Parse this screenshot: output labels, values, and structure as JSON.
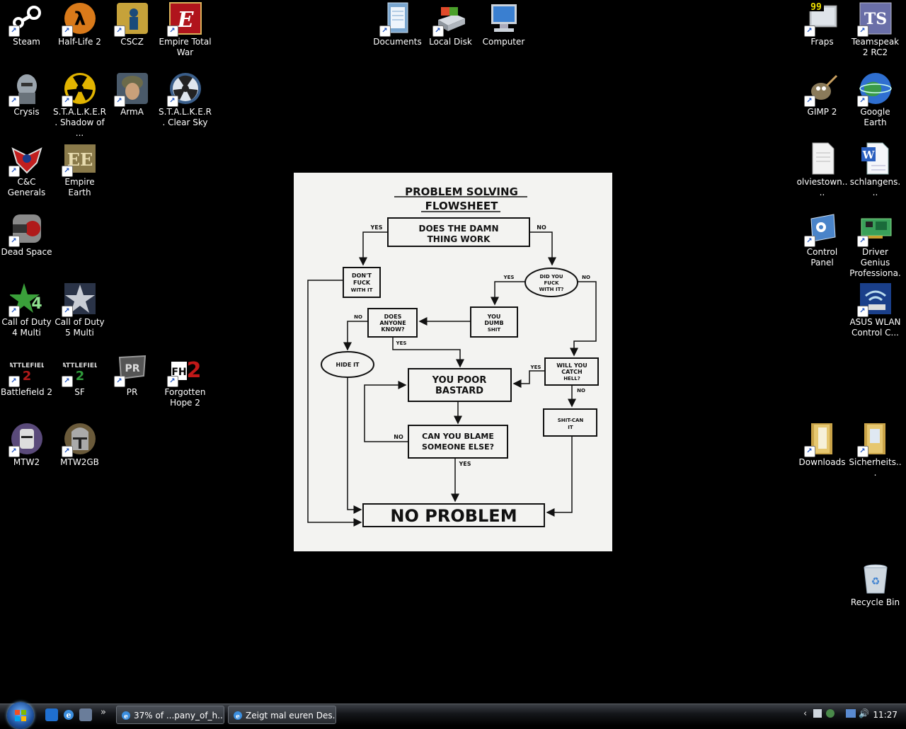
{
  "desktop": {
    "icons": [
      {
        "label": "Steam",
        "icon": "steam-icon",
        "color": "#2a2a2a"
      },
      {
        "label": "Half-Life 2",
        "icon": "half-life-icon",
        "color": "#d97a1a"
      },
      {
        "label": "CSCZ",
        "icon": "counter-strike-icon",
        "color": "#c6a23a"
      },
      {
        "label": "Empire Total War",
        "icon": "empire-total-war-icon",
        "color": "#b0141c"
      },
      {
        "label": "Crysis",
        "icon": "crysis-icon",
        "color": "#9aa4ad"
      },
      {
        "label": "S.T.A.L.K.E.R. Shadow of ...",
        "icon": "radiation-icon",
        "color": "#e2b400"
      },
      {
        "label": "ArmA",
        "icon": "soldier-icon",
        "color": "#6b6a4a"
      },
      {
        "label": "S.T.A.L.K.E.R. Clear Sky",
        "icon": "radiation-icon",
        "color": "#3a5e8a"
      },
      {
        "label": "C&C Generals",
        "icon": "eagle-emblem-icon",
        "color": "#c21f1f"
      },
      {
        "label": "Empire Earth",
        "icon": "empire-earth-icon",
        "color": "#8a7a4a"
      },
      {
        "label": "Dead Space",
        "icon": "dead-space-icon",
        "color": "#8a8a8a"
      },
      {
        "label": "Call of Duty 4 Multi",
        "icon": "cod4-icon",
        "color": "#3aa03a"
      },
      {
        "label": "Call of Duty 5 Multi",
        "icon": "star-icon",
        "color": "#4a5a7a"
      },
      {
        "label": "Battlefield 2",
        "icon": "battlefield-icon",
        "color": "#3a3a3a"
      },
      {
        "label": "SF",
        "icon": "battlefield-icon",
        "color": "#3a3a3a"
      },
      {
        "label": "PR",
        "icon": "project-reality-icon",
        "color": "#555"
      },
      {
        "label": "Forgotten Hope 2",
        "icon": "fh2-icon",
        "color": "#c01818"
      },
      {
        "label": "MTW2",
        "icon": "helmet-icon",
        "color": "#5a4a7a"
      },
      {
        "label": "MTW2GB",
        "icon": "helmet-icon",
        "color": "#6a5a3a"
      },
      {
        "label": "Documents",
        "icon": "documents-icon",
        "color": "#7aa6cf"
      },
      {
        "label": "Local Disk",
        "icon": "hard-disk-icon",
        "color": "#b0b6bd"
      },
      {
        "label": "Computer",
        "icon": "computer-icon",
        "color": "#3a7fd0"
      },
      {
        "label": "Fraps",
        "icon": "fraps-icon",
        "color": "#c9ced4"
      },
      {
        "label": "Teamspeak 2 RC2",
        "icon": "teamspeak-icon",
        "color": "#6a6fa8"
      },
      {
        "label": "GIMP 2",
        "icon": "gimp-icon",
        "color": "#8a7a5a"
      },
      {
        "label": "Google Earth",
        "icon": "globe-icon",
        "color": "#2f6fd0"
      },
      {
        "label": "olviestown....",
        "icon": "text-file-icon",
        "color": "#f2f2f2"
      },
      {
        "label": "schlangens...",
        "icon": "word-document-icon",
        "color": "#2a5fbf"
      },
      {
        "label": "Control Panel",
        "icon": "control-panel-icon",
        "color": "#4a84c9"
      },
      {
        "label": "Driver Genius Professiona...",
        "icon": "circuit-board-icon",
        "color": "#3aa05a"
      },
      {
        "label": "ASUS WLAN Control C...",
        "icon": "wireless-icon",
        "color": "#2a5fbf"
      },
      {
        "label": "Downloads",
        "icon": "folder-icon",
        "color": "#e6c770"
      },
      {
        "label": "Sicherheits...",
        "icon": "folder-icon",
        "color": "#e6c770"
      },
      {
        "label": "Recycle Bin",
        "icon": "recycle-bin-icon",
        "color": "#cfd8e0"
      }
    ],
    "fraps_fps": "99"
  },
  "wallpaper": {
    "title_line1": "PROBLEM SOLVING",
    "title_line2": "FLOWSHEET",
    "q_works_1": "DOES THE DAMN",
    "q_works_2": "THING WORK",
    "yes": "YES",
    "no": "NO",
    "dont_1": "DON'T",
    "dont_2": "FUCK",
    "dont_3": "WITH IT",
    "did_1": "DID YOU",
    "did_2": "FUCK",
    "did_3": "WITH IT?",
    "dumb_1": "YOU",
    "dumb_2": "DUMB",
    "dumb_3": "SHIT",
    "knows_1": "DOES",
    "knows_2": "ANYONE",
    "knows_3": "KNOW?",
    "hide": "HIDE IT",
    "poor_1": "YOU POOR",
    "poor_2": "BASTARD",
    "catch_1": "WILL YOU",
    "catch_2": "CATCH",
    "catch_3": "HELL?",
    "blame_1": "CAN YOU BLAME",
    "blame_2": "SOMEONE ELSE?",
    "shitcan_1": "SHIT-CAN",
    "shitcan_2": "IT",
    "no_problem": "NO PROBLEM"
  },
  "taskbar": {
    "tasks": [
      {
        "label": "37% of ...pany_of_h..."
      },
      {
        "label": "Zeigt mal euren Des..."
      }
    ],
    "chevron": "»",
    "tray_arrow": "‹",
    "clock": "11:27"
  }
}
